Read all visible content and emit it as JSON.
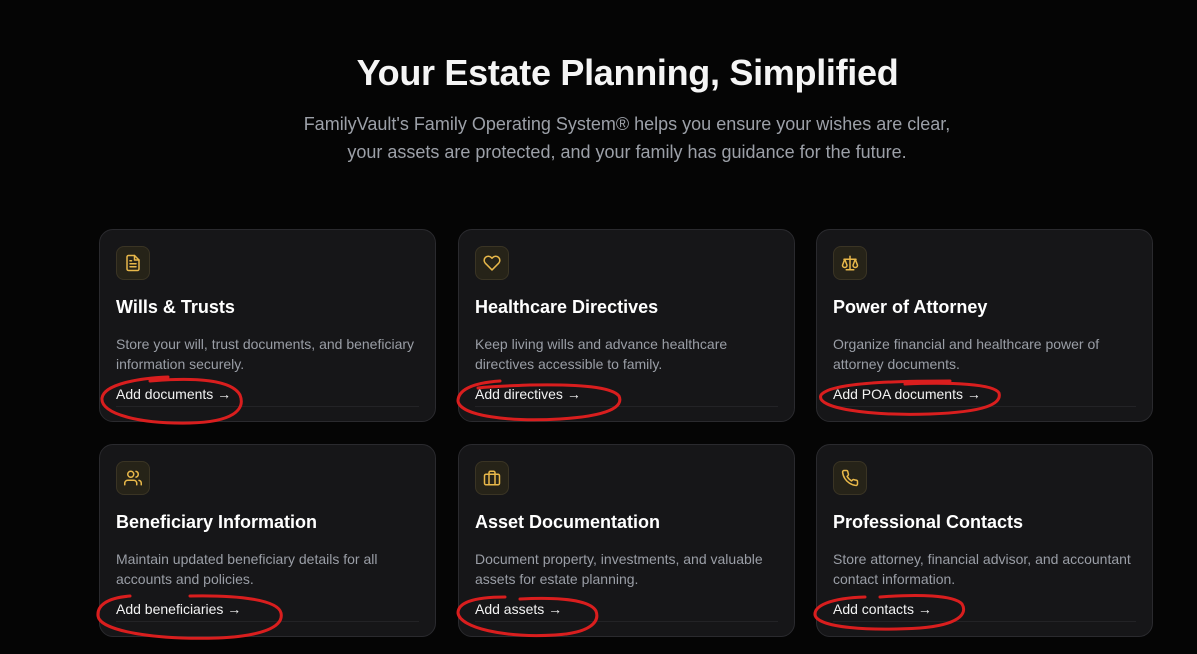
{
  "hero": {
    "title": "Your Estate Planning, Simplified",
    "subtitle": "FamilyVault's Family Operating System® helps you ensure your wishes are clear, your assets are protected, and your family has guidance for the future."
  },
  "colors": {
    "background": "#050505",
    "card_background": "#161618",
    "icon_accent": "#e8b84a",
    "annotation_red": "#d91e1e"
  },
  "cards": [
    {
      "icon": "document-icon",
      "title": "Wills & Trusts",
      "description": "Store your will, trust documents, and beneficiary information securely.",
      "link": "Add documents →"
    },
    {
      "icon": "heart-icon",
      "title": "Healthcare Directives",
      "description": "Keep living wills and advance healthcare directives accessible to family.",
      "link": "Add directives →"
    },
    {
      "icon": "scale-icon",
      "title": "Power of Attorney",
      "description": "Organize financial and healthcare power of attorney documents.",
      "link": "Add POA documents →"
    },
    {
      "icon": "users-icon",
      "title": "Beneficiary Information",
      "description": "Maintain updated beneficiary details for all accounts and policies.",
      "link": "Add beneficiaries →"
    },
    {
      "icon": "briefcase-icon",
      "title": "Asset Documentation",
      "description": "Document property, investments, and valuable assets for estate planning.",
      "link": "Add assets →"
    },
    {
      "icon": "phone-icon",
      "title": "Professional Contacts",
      "description": "Store attorney, financial advisor, and accountant contact information.",
      "link": "Add contacts →"
    }
  ]
}
